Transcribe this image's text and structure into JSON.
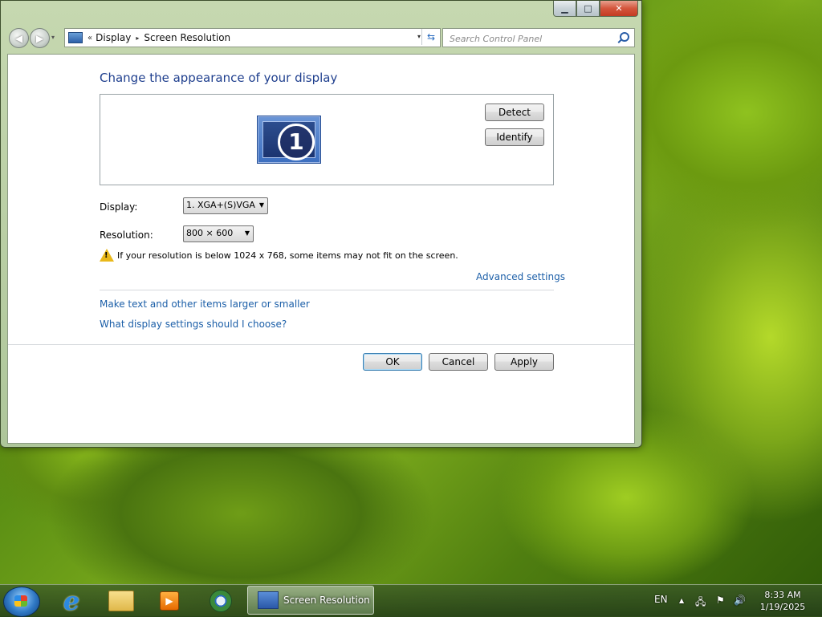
{
  "window": {
    "caption_buttons": {
      "minimize": "▁",
      "maximize": "□",
      "close": "✕"
    },
    "nav": {
      "back": "◀",
      "forward": "▶",
      "dropdown": "▾"
    },
    "address": {
      "chevron": "«",
      "crumbs": [
        "Display",
        "Screen Resolution"
      ],
      "separator": "▸",
      "dropdown": "▾",
      "refresh": "⇆"
    },
    "search": {
      "placeholder": "Search Control Panel"
    }
  },
  "content": {
    "title": "Change the appearance of your display",
    "monitor_number": "1",
    "detect_label": "Detect",
    "identify_label": "Identify",
    "display_label": "Display:",
    "display_value": "1. XGA+(S)VGA",
    "resolution_label": "Resolution:",
    "resolution_value": "800 × 600",
    "warning_mark": "!",
    "warning_text": "If your resolution is below 1024 x 768, some items may not fit on the screen.",
    "advanced_link": "Advanced settings",
    "link_text_size": "Make text and other items larger or smaller",
    "link_help": "What display settings should I choose?",
    "ok_label": "OK",
    "cancel_label": "Cancel",
    "apply_label": "Apply"
  },
  "taskbar": {
    "active_task": "Screen Resolution",
    "ie_glyph": "e",
    "wmp_glyph": "▶",
    "language": "EN",
    "tray_up": "▲",
    "tray_network": "🖧",
    "tray_flag": "⚑",
    "tray_volume": "🔊",
    "time": "8:33 AM",
    "date": "1/19/2025"
  },
  "colors": {
    "title": "#1f3f8e",
    "link": "#1c5fa8",
    "warning": "#e9b81a"
  }
}
